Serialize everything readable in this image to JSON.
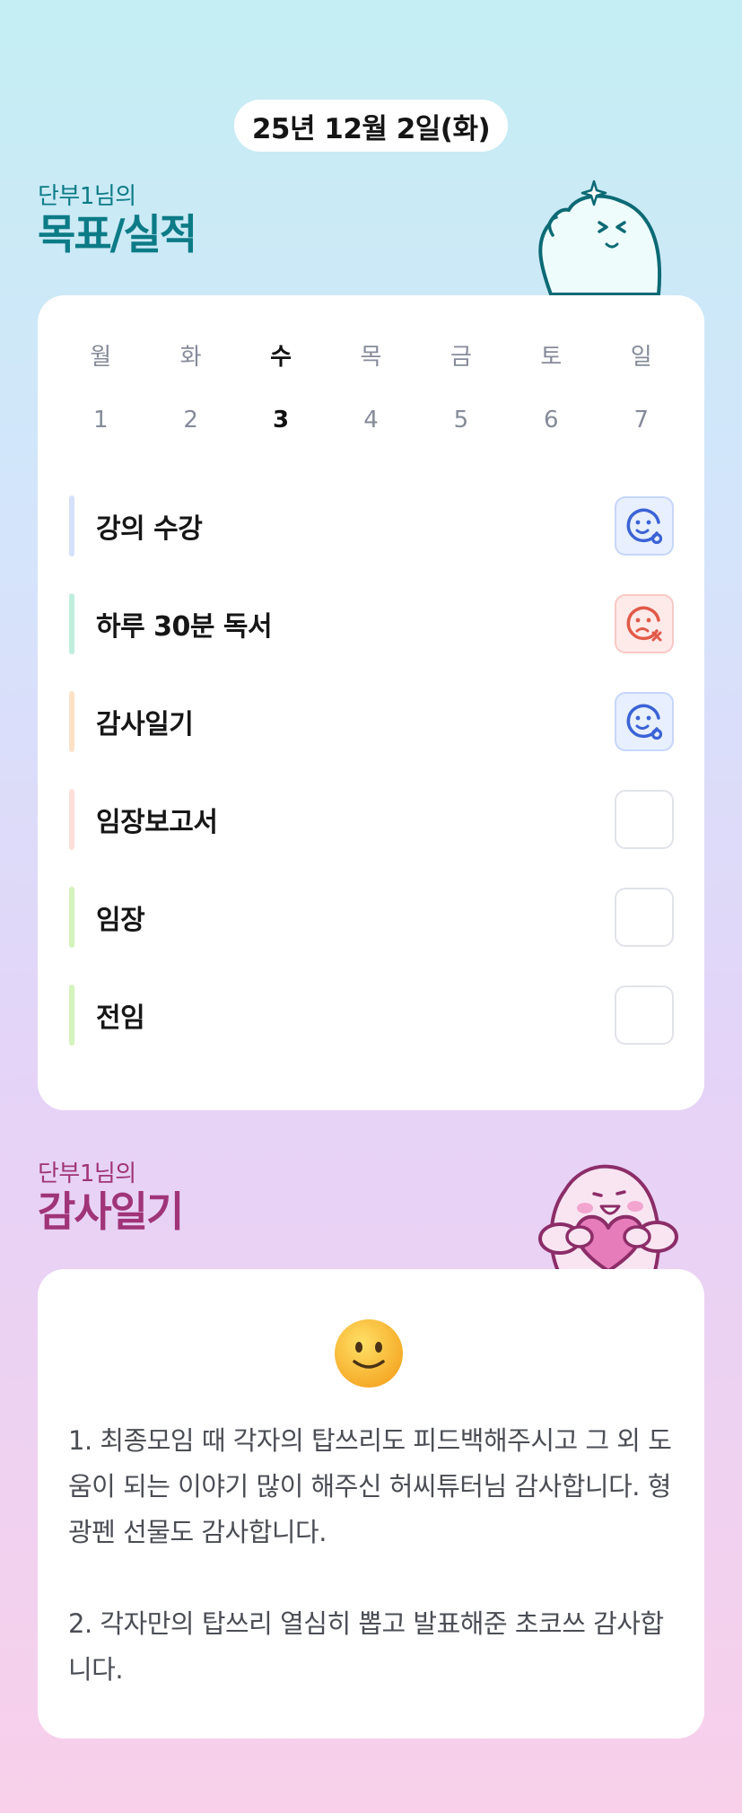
{
  "date": "25년 12월 2일(화)",
  "goals_section": {
    "subtitle": "단부1님의",
    "title": "목표/실적"
  },
  "week": {
    "days": [
      "월",
      "화",
      "수",
      "목",
      "금",
      "토",
      "일"
    ],
    "dates": [
      "1",
      "2",
      "3",
      "4",
      "5",
      "6",
      "7"
    ],
    "active_index": 2
  },
  "goals": [
    {
      "label": "강의 수강",
      "status": "done",
      "color": "#d5e1fa"
    },
    {
      "label": "하루 30분 독서",
      "status": "failed",
      "color": "#c0eedd"
    },
    {
      "label": "감사일기",
      "status": "done",
      "color": "#fde1c6"
    },
    {
      "label": "임장보고서",
      "status": "empty",
      "color": "#fddfd9"
    },
    {
      "label": "임장",
      "status": "empty",
      "color": "#d4f3bb"
    },
    {
      "label": "전임",
      "status": "empty",
      "color": "#d4f3bb"
    }
  ],
  "status_icons": {
    "done": "happy-face-icon",
    "failed": "sad-face-x-icon",
    "empty": ""
  },
  "diary_section": {
    "subtitle": "단부1님의",
    "title": "감사일기"
  },
  "diary": {
    "mood_icon": "slightly-smiling-face-icon",
    "entries": [
      "1. 최종모임 때 각자의 탑쓰리도 피드백해주시고 그 외 도움이 되는 이야기 많이 해주신 허씨튜터님 감사합니다. 형광펜 선물도 감사합니다.",
      "2. 각자만의 탑쓰리 열심히 뽑고 발표해준 초코쓰 감사합니다."
    ]
  },
  "colors": {
    "goal_heading": "#0c7b86",
    "diary_heading": "#a03478",
    "done_icon": "#3b63d6",
    "failed_icon": "#e25a48"
  }
}
